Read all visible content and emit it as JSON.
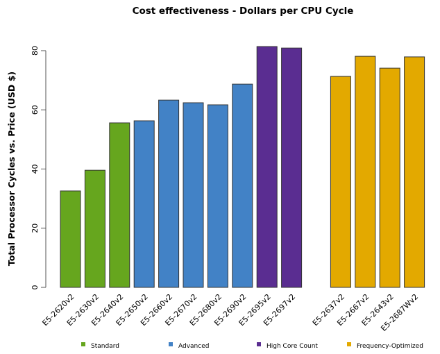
{
  "chart_data": {
    "type": "bar",
    "title": "Cost effectiveness - Dollars per CPU Cycle",
    "xlabel": "",
    "ylabel": "Total Processor Cycles vs. Price (USD $)",
    "ylim": [
      0,
      80
    ],
    "yticks": [
      0,
      20,
      40,
      60,
      80
    ],
    "grid": false,
    "legend_position": "bottom",
    "categories": [
      "E5-2620v2",
      "E5-2630v2",
      "E5-2640v2",
      "E5-2650v2",
      "E5-2660v2",
      "E5-2670v2",
      "E5-2680v2",
      "E5-2690v2",
      "E5-2695v2",
      "E5-2697v2",
      "E5-2637v2",
      "E5-2667v2",
      "E5-2643v2",
      "E5-2687Wv2"
    ],
    "values": [
      32.6,
      39.6,
      55.6,
      56.3,
      63.3,
      62.4,
      61.7,
      68.7,
      81.4,
      80.9,
      71.3,
      78.1,
      74.1,
      77.9
    ],
    "groups": [
      "Standard",
      "Standard",
      "Standard",
      "Advanced",
      "Advanced",
      "Advanced",
      "Advanced",
      "Advanced",
      "High Core Count",
      "High Core Count",
      "Frequency-Optimized",
      "Frequency-Optimized",
      "Frequency-Optimized",
      "Frequency-Optimized"
    ],
    "legend": [
      {
        "label": "Standard",
        "color": "#66a61e"
      },
      {
        "label": "Advanced",
        "color": "#4282c6"
      },
      {
        "label": "High Core Count",
        "color": "#5a2d91"
      },
      {
        "label": "Frequency-Optimized",
        "color": "#e3a900"
      }
    ]
  }
}
